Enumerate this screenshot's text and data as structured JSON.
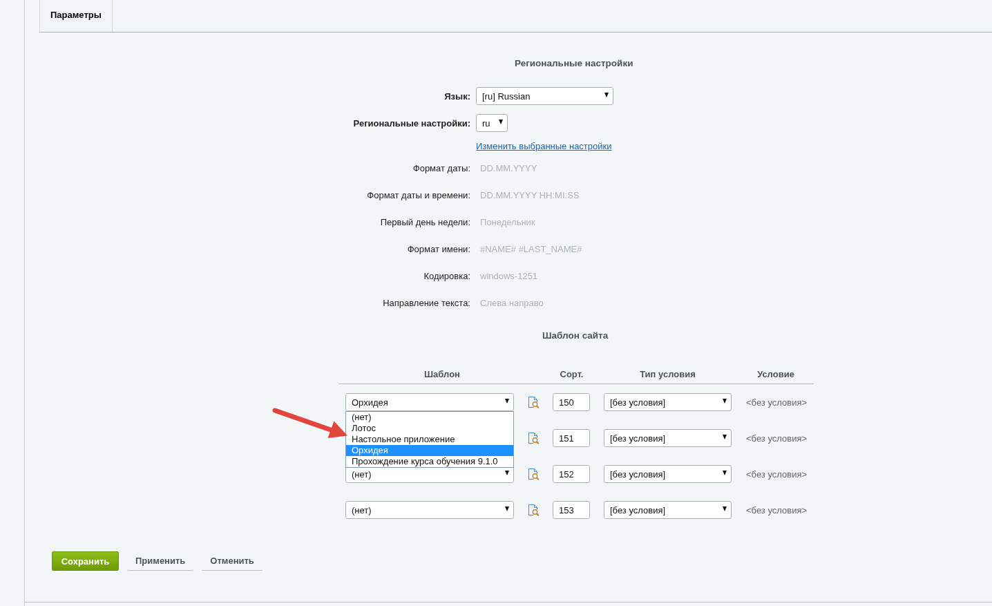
{
  "tabs": [
    {
      "label": "Параметры",
      "selected": true
    }
  ],
  "regional": {
    "title": "Региональные настройки",
    "selects": [
      {
        "label": "Язык:",
        "value": "[ru] Russian"
      },
      {
        "label": "Региональные настройки:",
        "value": "ru"
      }
    ],
    "link": "Изменить выбранные настройки",
    "fields": [
      {
        "label": "Формат даты:",
        "value": "DD.MM.YYYY"
      },
      {
        "label": "Формат даты и времени:",
        "value": "DD.MM.YYYY HH:MI:SS"
      },
      {
        "label": "Первый день недели:",
        "value": "Понедельник"
      },
      {
        "label": "Формат имени:",
        "value": "#NAME# #LAST_NAME#"
      },
      {
        "label": "Кодировка:",
        "value": "windows-1251"
      },
      {
        "label": "Направление текста:",
        "value": "Слева направо"
      }
    ]
  },
  "template_section": {
    "title": "Шаблон сайта",
    "columns": [
      "Шаблон",
      "Сорт.",
      "Тип условия",
      "Условие"
    ],
    "rows": [
      {
        "template": "Орхидея",
        "sort": "150",
        "condition_type": "[без условия]",
        "condition": "<без условия>",
        "options": [
          {
            "label": "(нет)",
            "selected": false
          },
          {
            "label": "Лотос",
            "selected": false
          },
          {
            "label": "Настольное приложение",
            "selected": false
          },
          {
            "label": "Орхидея",
            "selected": true
          },
          {
            "label": "Прохождение курса обучения 9.1.0",
            "selected": false
          }
        ]
      },
      {
        "sort": "151",
        "condition_type": "[без условия]",
        "condition": "<без условия>"
      },
      {
        "template": "(нет)",
        "sort": "152",
        "condition_type": "[без условия]",
        "condition": "<без условия>"
      },
      {
        "template": "(нет)",
        "sort": "153",
        "condition_type": "[без условия]",
        "condition": "<без условия>"
      }
    ]
  },
  "buttons": [
    {
      "label": "Сохранить",
      "kind": "primary"
    },
    {
      "label": "Применить",
      "kind": "plain"
    },
    {
      "label": "Отменить",
      "kind": "plain"
    }
  ]
}
